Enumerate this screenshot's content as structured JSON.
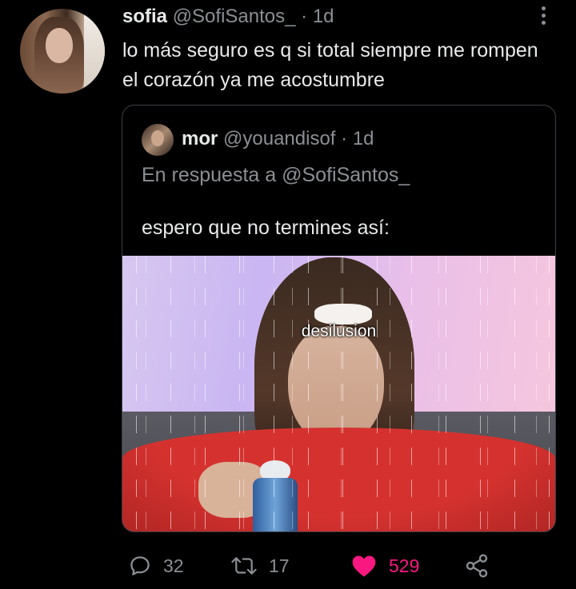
{
  "tweet": {
    "author_name": "sofia",
    "author_handle": "@SofiSantos_",
    "separator": "·",
    "time": "1d",
    "text": "lo más seguro es q si total siempre me rompen el corazón ya me acostumbre"
  },
  "quote": {
    "author_name": "mor",
    "author_handle": "@youandisof",
    "separator": "·",
    "time": "1d",
    "reply_to": "En respuesta a @SofiSantos_",
    "text": "espero que no termines así:",
    "media_caption": "desilusion"
  },
  "actions": {
    "replies": "32",
    "retweets": "17",
    "likes": "529"
  },
  "colors": {
    "background": "#000000",
    "primary_text": "#e7e9ea",
    "secondary_text": "#8b8f94",
    "like": "#f91880"
  },
  "icons": {
    "reply": "reply-icon",
    "retweet": "retweet-icon",
    "like": "heart-icon",
    "share": "share-icon",
    "more": "more-options-icon"
  }
}
